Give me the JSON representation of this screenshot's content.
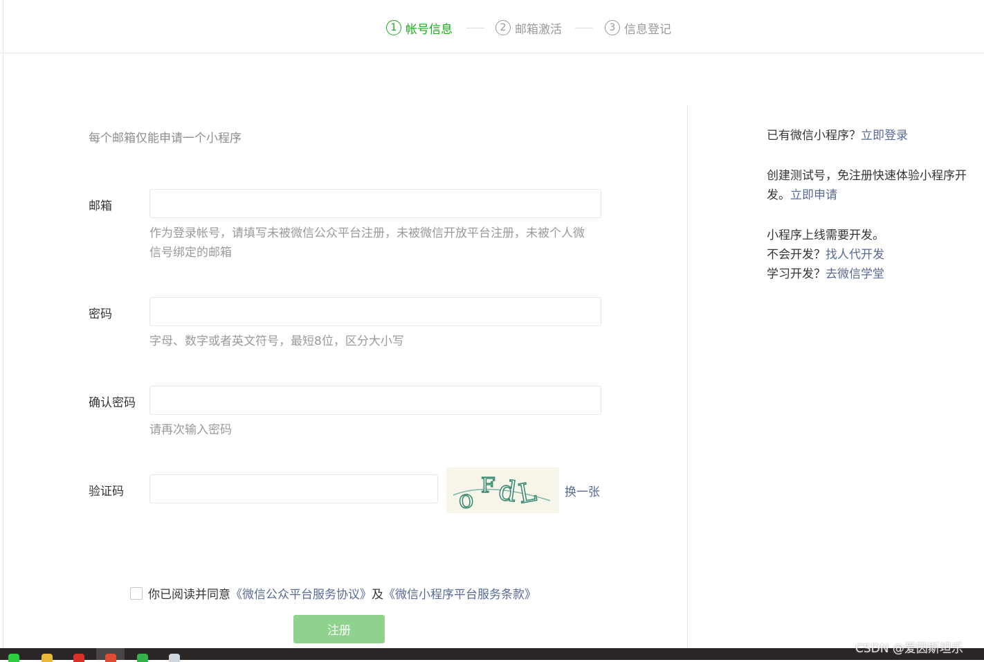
{
  "steps": [
    {
      "num": "1",
      "label": "帐号信息"
    },
    {
      "num": "2",
      "label": "邮箱激活"
    },
    {
      "num": "3",
      "label": "信息登记"
    }
  ],
  "form": {
    "tip": "每个邮箱仅能申请一个小程序",
    "email_label": "邮箱",
    "email_value": "",
    "email_hint_line1": "作为登录帐号，请填写未被微信公众平台注册，未被微信开放平台注册，未被个人微",
    "email_hint_line2": "信号绑定的邮箱",
    "password_label": "密码",
    "password_value": "",
    "password_hint": "字母、数字或者英文符号，最短8位，区分大小写",
    "confirm_label": "确认密码",
    "confirm_value": "",
    "confirm_hint": "请再次输入密码",
    "captcha_label": "验证码",
    "captcha_value": "",
    "captcha_text": "oFdL",
    "captcha_refresh": "换一张",
    "agree_prefix": "你已阅读并同意",
    "agree_link1": "《微信公众平台服务协议》",
    "agree_mid": "及",
    "agree_link2": "《微信小程序平台服务条款》",
    "agree_checked": false,
    "submit_label": "注册"
  },
  "side": {
    "have_prefix": "已有微信小程序？",
    "have_link": "立即登录",
    "test_line1": "创建测试号，免注册快速体验小程序开",
    "test_line2_prefix": "发。",
    "test_link": "立即申请",
    "online_line": "小程序上线需要开发。",
    "cant_prefix": "不会开发？",
    "cant_link": "找人代开发",
    "learn_prefix": "学习开发？",
    "learn_link": "去微信学堂"
  },
  "watermark": "CSDN @爱因斯坦乐",
  "colors": {
    "accent_green": "#1aad19",
    "link_blue": "#576b95",
    "button_disabled": "#8ed28d"
  }
}
